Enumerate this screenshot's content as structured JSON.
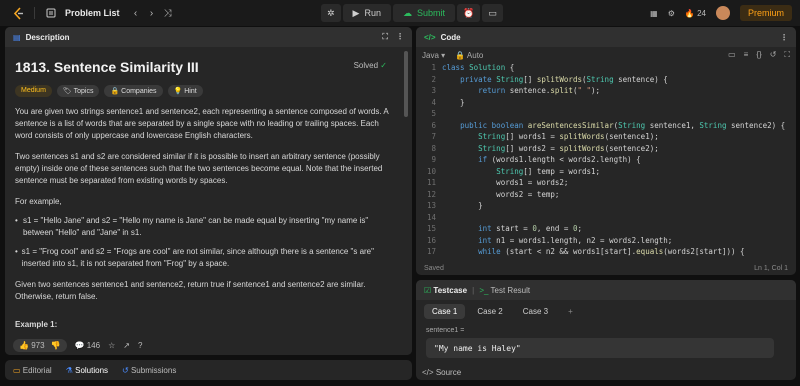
{
  "topbar": {
    "title": "Problem List",
    "run_label": "Run",
    "submit_label": "Submit",
    "streak": "24",
    "premium_label": "Premium"
  },
  "description": {
    "tab_label": "Description",
    "title": "1813. Sentence Similarity III",
    "solved_label": "Solved",
    "chips": {
      "difficulty": "Medium",
      "topics": "Topics",
      "companies": "Companies",
      "hint": "Hint"
    },
    "p1": "You are given two strings sentence1 and sentence2, each representing a sentence composed of words. A sentence is a list of words that are separated by a single space with no leading or trailing spaces. Each word consists of only uppercase and lowercase English characters.",
    "p2": "Two sentences s1 and s2 are considered similar if it is possible to insert an arbitrary sentence (possibly empty) inside one of these sentences such that the two sentences become equal. Note that the inserted sentence must be separated from existing words by spaces.",
    "p3": "For example,",
    "b1": "s1 = \"Hello Jane\" and s2 = \"Hello my name is Jane\" can be made equal by inserting \"my name is\" between \"Hello\" and \"Jane\" in s1.",
    "b2": "s1 = \"Frog cool\" and s2 = \"Frogs are cool\" are not similar, since although there is a sentence \"s are\" inserted into s1, it is not separated from \"Frog\" by a space.",
    "p4": "Given two sentences sentence1 and sentence2, return true if sentence1 and sentence2 are similar. Otherwise, return false.",
    "example_heading": "Example 1:",
    "likes": "973",
    "comments": "146"
  },
  "bottom_tabs": {
    "editorial": "Editorial",
    "solutions": "Solutions",
    "submissions": "Submissions"
  },
  "code": {
    "tab_label": "Code",
    "language": "Java",
    "mode": "Auto",
    "status_left": "Saved",
    "status_right": "Ln 1, Col 1",
    "lines": [
      "class Solution {",
      "    private String[] splitWords(String sentence) {",
      "        return sentence.split(\" \");",
      "    }",
      "",
      "    public boolean areSentencesSimilar(String sentence1, String sentence2) {",
      "        String[] words1 = splitWords(sentence1);",
      "        String[] words2 = splitWords(sentence2);",
      "        if (words1.length < words2.length) {",
      "            String[] temp = words1;",
      "            words1 = words2;",
      "            words2 = temp;",
      "        }",
      "",
      "        int start = 0, end = 0;",
      "        int n1 = words1.length, n2 = words2.length;",
      "        while (start < n2 && words1[start].equals(words2[start])) {"
    ]
  },
  "testcase": {
    "tab_label": "Testcase",
    "result_label": "Test Result",
    "cases": [
      "Case 1",
      "Case 2",
      "Case 3"
    ],
    "var_label": "sentence1 =",
    "var_value": "\"My name is Haley\"",
    "source_label": "Source"
  },
  "colors": {
    "accent": "#ffa116",
    "green": "#2cbb5d",
    "panel": "#262626",
    "bg": "#0f0f0f"
  }
}
